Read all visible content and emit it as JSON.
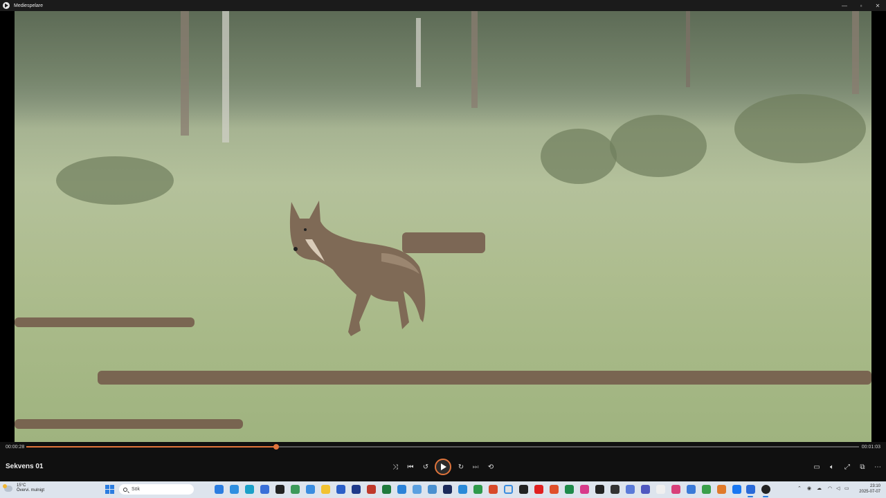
{
  "window": {
    "title": "Mediespelare",
    "controls": [
      "minimize-icon",
      "maximize-icon",
      "close-icon"
    ]
  },
  "player": {
    "current_time": "00:00:28",
    "duration": "00:01:03",
    "progress_fraction": 0.3,
    "title": "Sekvens 01",
    "accent_color": "#e0743b",
    "buttons": [
      "shuffle-icon",
      "previous-icon",
      "rewind-10-icon",
      "play-icon",
      "forward-30-icon",
      "next-icon",
      "repeat-icon"
    ],
    "right_buttons": [
      "subtitles-icon",
      "volume-icon",
      "fullscreen-icon",
      "miniplayer-icon",
      "more-icon"
    ]
  },
  "taskbar": {
    "weather_temp": "15°C",
    "weather_desc": "Övervi. mulnigt",
    "search_placeholder": "Sök",
    "time": "23:10",
    "date": "2025-07-07",
    "pinned_apps": [
      "file-explorer",
      "edge",
      "mail",
      "calendar",
      "photos",
      "store",
      "word",
      "excel",
      "powerpoint",
      "chrome",
      "firefox",
      "media-player"
    ]
  }
}
